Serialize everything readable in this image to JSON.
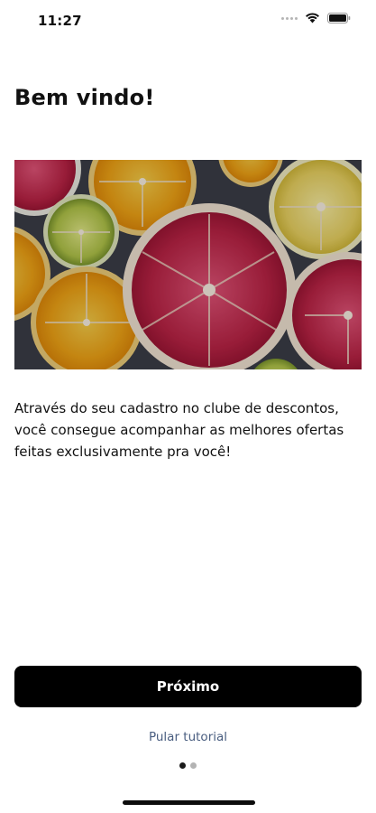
{
  "status_bar": {
    "time": "11:27",
    "icons": [
      "signal-dots-icon",
      "wifi-icon",
      "battery-icon"
    ]
  },
  "welcome": {
    "title": "Bem vindo!",
    "image": "citrus-fruit-slices",
    "description": "Através do seu cadastro no clube de descontos, você consegue acompanhar as melhores ofertas feitas exclusivamente pra você!"
  },
  "actions": {
    "next_label": "Próximo",
    "skip_label": "Pular tutorial"
  },
  "pagination": {
    "total": 2,
    "current": 1
  },
  "colors": {
    "button_bg": "#000000",
    "button_text": "#ffffff",
    "link": "#4a5e80",
    "dot_active": "#1a1a1a",
    "dot_inactive": "#b3b3b3"
  }
}
